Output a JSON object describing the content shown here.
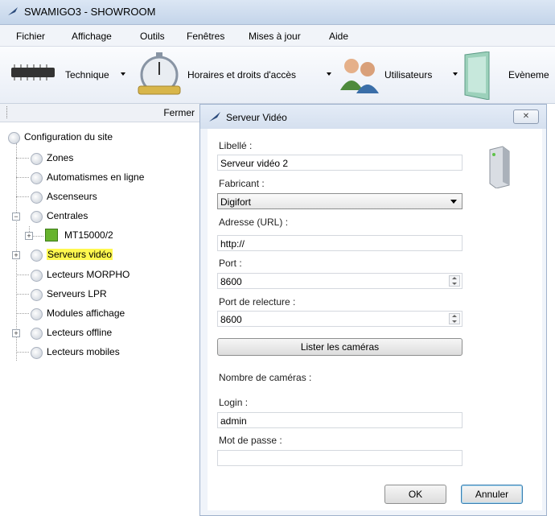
{
  "app": {
    "title": "SWAMIGO3 - SHOWROOM"
  },
  "menu": [
    "Fichier",
    "Affichage",
    "Outils",
    "Fenêtres",
    "Mises à jour",
    "Aide"
  ],
  "toolbar": {
    "technique": "Technique",
    "horaires": "Horaires et droits d'accès",
    "utilisateurs": "Utilisateurs",
    "evenements": "Evèneme"
  },
  "panel": {
    "close_label": "Fermer",
    "tree": {
      "root": "Configuration du site",
      "zones": "Zones",
      "automatismes": "Automatismes en ligne",
      "ascenseurs": "Ascenseurs",
      "centrales": "Centrales",
      "mt": "MT15000/2",
      "serveurs_video": "Serveurs vidéo",
      "morpho": "Lecteurs MORPHO",
      "lpr": "Serveurs LPR",
      "modules": "Modules affichage",
      "offline": "Lecteurs offline",
      "mobiles": "Lecteurs mobiles"
    }
  },
  "dialog": {
    "title": "Serveur Vidéo",
    "close_glyph": "✕",
    "libelle_label": "Libellé :",
    "libelle_value": "Serveur vidéo 2",
    "fabricant_label": "Fabricant :",
    "fabricant_value": "Digifort",
    "url_label": "Adresse (URL) :",
    "url_value": "http://",
    "port_label": "Port :",
    "port_value": "8600",
    "relecture_label": "Port de relecture :",
    "relecture_value": "8600",
    "lister_label": "Lister les caméras",
    "nb_cameras_label": "Nombre de caméras :",
    "login_label": "Login :",
    "login_value": "admin",
    "password_label": "Mot de passe :",
    "password_value": "",
    "ok_label": "OK",
    "cancel_label": "Annuler"
  },
  "colors": {
    "highlight": "#fff84e",
    "accent": "#3c7fb1"
  }
}
